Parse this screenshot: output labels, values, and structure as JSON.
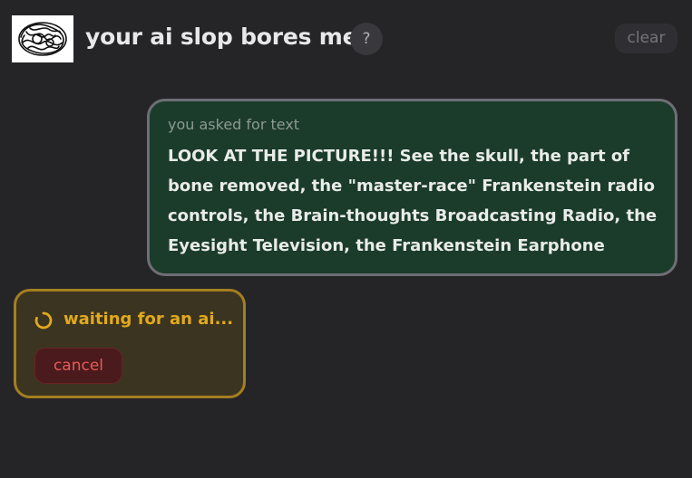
{
  "header": {
    "title": "your ai slop bores me",
    "help_label": "?",
    "clear_label": "clear",
    "logo_icon": "scribble-brain-icon"
  },
  "user_message": {
    "caption": "you asked for text",
    "text": "LOOK AT THE PICTURE!!! See the skull, the part of bone removed, the \"master-race\" Frankenstein radio controls, the Brain-thoughts Broadcasting Radio, the Eyesight Television, the Frankenstein Earphone"
  },
  "status": {
    "waiting_text": "waiting for an ai...",
    "cancel_label": "cancel",
    "spinner_icon": "loading-spinner-icon"
  },
  "colors": {
    "background": "#252528",
    "user_bubble_bg": "#1b3b2b",
    "user_bubble_border": "#6e6e76",
    "waiting_accent": "#e2a91c",
    "waiting_border": "#a47f20",
    "cancel_text": "#e85a58"
  }
}
